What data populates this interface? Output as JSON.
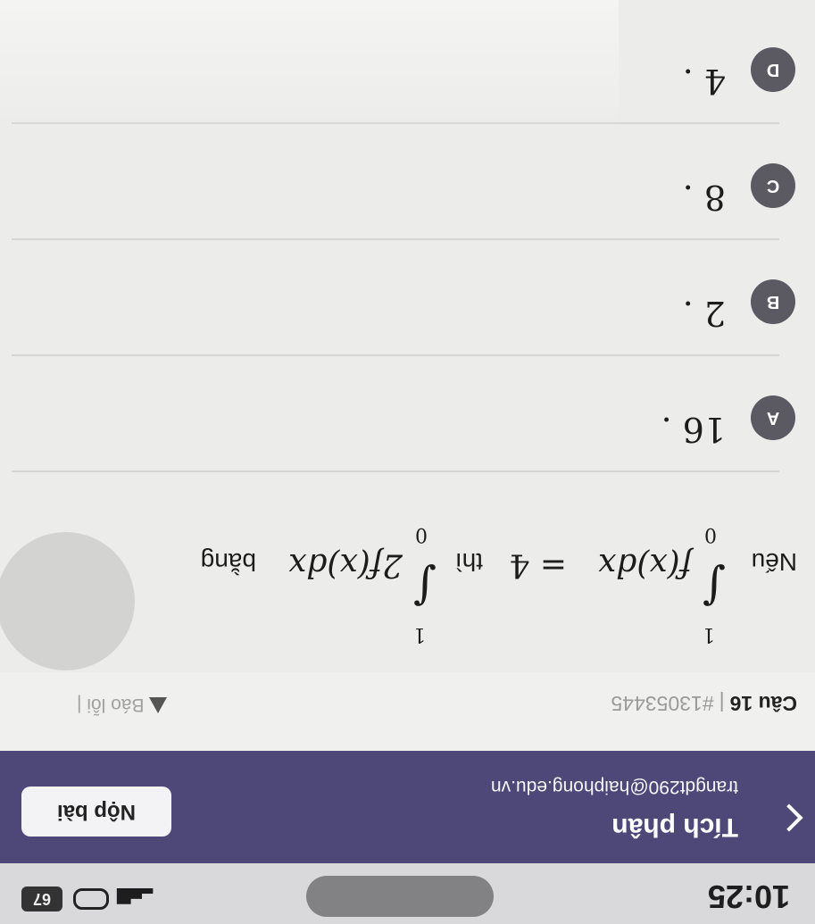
{
  "status_bar": {
    "time": "10:25",
    "battery": "67"
  },
  "header": {
    "title": "Tích phân",
    "email": "trangdt290@haiphong.edu.vn",
    "submit_label": "Nộp bài"
  },
  "question": {
    "number_label": "Câu 16",
    "separator": "|",
    "id": "#13053445",
    "report_label": "Báo lỗi |",
    "lead": "Nếu",
    "integral1": {
      "upper": "1",
      "lower": "0",
      "integrand": "f(x)dx",
      "equals": "= 4"
    },
    "connector": "thì",
    "integral2": {
      "upper": "1",
      "lower": "0",
      "integrand": "2f(x)dx"
    },
    "tail": "bằng"
  },
  "options": [
    {
      "letter": "A",
      "text": "16 ."
    },
    {
      "letter": "B",
      "text": "2 ."
    },
    {
      "letter": "C",
      "text": "8 ."
    },
    {
      "letter": "D",
      "text": "4 ."
    }
  ]
}
